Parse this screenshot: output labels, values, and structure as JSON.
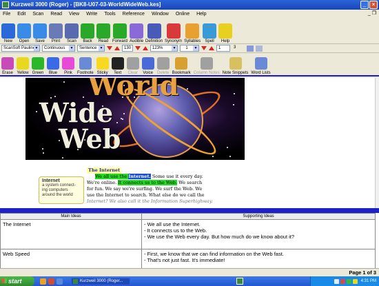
{
  "window": {
    "title": "Kurzweil 3000 (Roger) - [BK8-U07-03-WorldWideWeb.kes]",
    "controls": [
      "minimize",
      "maximize",
      "close"
    ]
  },
  "menubar": {
    "items": [
      "File",
      "Edit",
      "Scan",
      "Read",
      "View",
      "Write",
      "Tools",
      "Reference",
      "Window",
      "Online",
      "Help"
    ]
  },
  "toolbar_main": {
    "items": [
      {
        "label": "New",
        "icon": "new-icon",
        "color": "#2a6ad8"
      },
      {
        "label": "Open",
        "icon": "open-icon",
        "color": "#3a8ae8"
      },
      {
        "label": "Save",
        "icon": "save-icon",
        "color": "#3a8ae8"
      },
      {
        "label": "Print",
        "icon": "print-icon",
        "color": "#6a7ab8"
      },
      {
        "label": "Scan",
        "icon": "scan-icon",
        "color": "#5a6ab0"
      },
      {
        "label": "Back",
        "icon": "back-icon",
        "color": "#2aa82a"
      },
      {
        "label": "Read",
        "icon": "read-icon",
        "color": "#2aa82a"
      },
      {
        "label": "Forward",
        "icon": "forward-icon",
        "color": "#2aa82a"
      },
      {
        "label": "Audible",
        "icon": "audible-icon",
        "color": "#8a6ad8"
      },
      {
        "label": "Definition",
        "icon": "definition-icon",
        "color": "#4a5ab8"
      },
      {
        "label": "Synonym",
        "icon": "synonym-icon",
        "color": "#d83a3a"
      },
      {
        "label": "Syllables",
        "icon": "syllables-icon",
        "color": "#e8a030"
      },
      {
        "label": "Spell",
        "icon": "spell-icon",
        "color": "#3a9ad8"
      },
      {
        "label": "Help",
        "icon": "help-icon",
        "color": "#e8d020"
      }
    ]
  },
  "toolbar_reading": {
    "voice": "ScanSoft Pauline",
    "reading_mode": "Continuous",
    "reading_unit": "Sentence",
    "speed": "130",
    "zoom": "123%",
    "page_current": "1",
    "page_jump": "1",
    "page_total": "3"
  },
  "toolbar_tools": {
    "items": [
      {
        "label": "Erase",
        "icon": "eraser-icon",
        "color": "#c84ab8",
        "enabled": true
      },
      {
        "label": "Yellow",
        "icon": "yellow-highlighter-icon",
        "color": "#e8d820",
        "enabled": true
      },
      {
        "label": "Green",
        "icon": "green-highlighter-icon",
        "color": "#2ab82a",
        "enabled": true
      },
      {
        "label": "Blue",
        "icon": "blue-highlighter-icon",
        "color": "#3a6ae8",
        "enabled": true
      },
      {
        "label": "Pink",
        "icon": "pink-highlighter-icon",
        "color": "#e84ad8",
        "enabled": true
      },
      {
        "label": "Footnote",
        "icon": "footnote-icon",
        "color": "#6a8ad8",
        "enabled": true
      },
      {
        "label": "Sticky",
        "icon": "sticky-note-icon",
        "color": "#f8d820",
        "enabled": true
      },
      {
        "label": "Text",
        "icon": "text-icon",
        "color": "#222222",
        "enabled": true
      },
      {
        "label": "Clear",
        "icon": "clear-icon",
        "color": "#a0a0a0",
        "enabled": false
      },
      {
        "label": "Voice",
        "icon": "voice-icon",
        "color": "#4a6ad8",
        "enabled": true
      },
      {
        "label": "Delete",
        "icon": "delete-icon",
        "color": "#a0a0a0",
        "enabled": false
      },
      {
        "label": "Bookmark",
        "icon": "bookmark-icon",
        "color": "#d8a030",
        "enabled": true
      },
      {
        "label": "Column Notes",
        "icon": "column-notes-icon",
        "color": "#a0a0a0",
        "enabled": false
      },
      {
        "label": "Note Snippets",
        "icon": "note-snippets-icon",
        "color": "#d8c060",
        "enabled": true
      },
      {
        "label": "Word Lists",
        "icon": "word-lists-icon",
        "color": "#6a8ad8",
        "enabled": true
      }
    ]
  },
  "document": {
    "picture_words": [
      "World",
      "Wide",
      "Web"
    ],
    "footnote": {
      "title": "Internet",
      "body": "a system connect-ing computers around the world"
    },
    "heading": "The Internet",
    "lines": [
      {
        "parts": [
          {
            "t": "We all use the ",
            "hl": "green"
          },
          {
            "t": "Internet.",
            "hl": "blue"
          },
          {
            "t": " Some use it every day.",
            "hl": ""
          }
        ]
      },
      {
        "parts": [
          {
            "t": "We're online. ",
            "hl": ""
          },
          {
            "t": "It connects us to the Web.",
            "hl": "green"
          },
          {
            "t": " We search",
            "hl": ""
          }
        ]
      },
      {
        "parts": [
          {
            "t": "for fun. We say we're surfing. We surf the Web. We",
            "hl": ""
          }
        ]
      },
      {
        "parts": [
          {
            "t": "use the Internet to search. What else do we call the",
            "hl": ""
          }
        ]
      },
      {
        "parts": [
          {
            "t": "Internet? We also call it the Information Superhighway.",
            "hl": "faded"
          }
        ]
      }
    ]
  },
  "column_notes": {
    "headers": [
      "Main Ideas",
      "Supporting Ideas"
    ],
    "rows": [
      {
        "main": "The Internet",
        "supporting": [
          "- We all use the Internet.",
          "- It connects us to the Web.",
          "- We use the Web every day. But how much do we know about it?"
        ]
      },
      {
        "main": "Web Speed",
        "supporting": [
          "- First, we know that we can find information on the Web fast.",
          "- That's not just fast. It's immediate!"
        ]
      }
    ]
  },
  "status": {
    "page": "Page 1 of 3"
  },
  "taskbar": {
    "start": "start",
    "active_task": "Kurzweil 3000 (Roger...",
    "clock": "4:31 PM"
  }
}
